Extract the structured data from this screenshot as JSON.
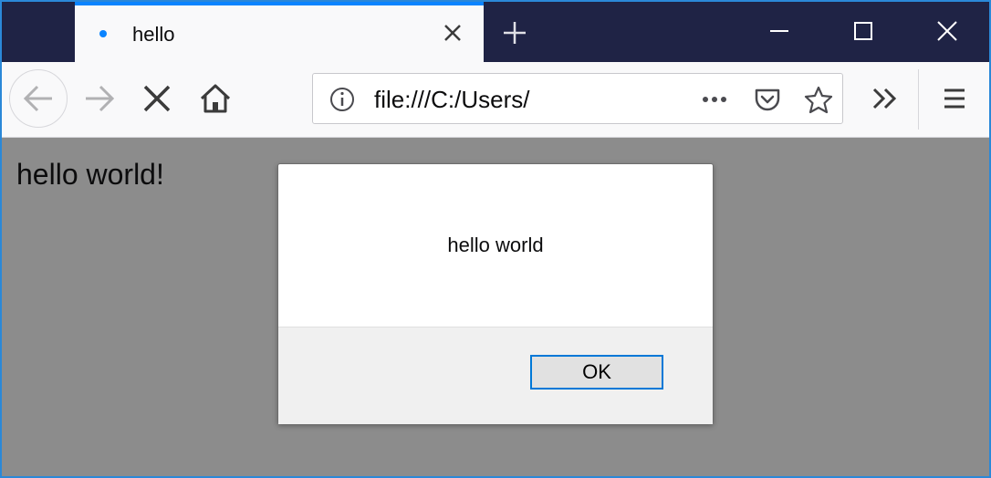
{
  "tabs": [
    {
      "title": "hello",
      "active": true,
      "loading": true
    }
  ],
  "titlebar": {
    "new_tab_icon": "plus-icon",
    "minimize_icon": "minimize-icon",
    "maximize_icon": "maximize-icon",
    "close_icon": "close-icon"
  },
  "toolbar": {
    "back_icon": "arrow-left-icon",
    "forward_icon": "arrow-right-icon",
    "stop_icon": "stop-icon",
    "home_icon": "home-icon",
    "overflow_icon": "chevron-double-right-icon",
    "menu_icon": "hamburger-menu-icon"
  },
  "urlbar": {
    "value": "file:///C:/Users/",
    "info_icon": "info-icon",
    "page_actions_icon": "more-horizontal-icon",
    "pocket_icon": "pocket-icon",
    "bookmark_icon": "star-icon"
  },
  "page": {
    "body_text": "hello world!"
  },
  "dialog": {
    "message": "hello world",
    "ok_label": "OK"
  },
  "colors": {
    "accent": "#0a84ff",
    "titlebar": "#1f2345",
    "content_overlay": "#8c8c8c",
    "ok_border": "#0078d7"
  }
}
